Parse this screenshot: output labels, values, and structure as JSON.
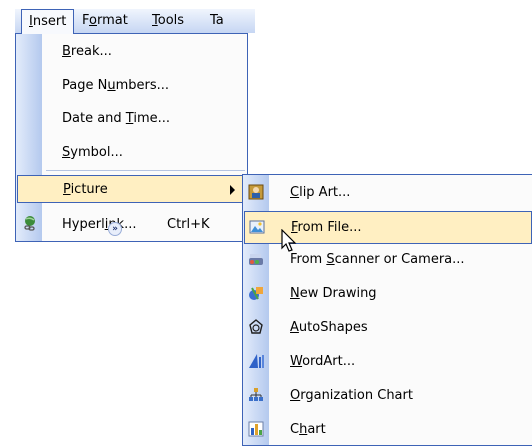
{
  "menubar": [
    {
      "label": "Insert",
      "u": "I",
      "rest": "nsert"
    },
    {
      "label": "Format",
      "pre": "F",
      "u": "o",
      "rest": "rmat"
    },
    {
      "label": "Tools",
      "u": "T",
      "rest": "ools"
    },
    {
      "label": "Ta"
    }
  ],
  "insert_menu": {
    "break": {
      "u": "B",
      "rest": "reak..."
    },
    "page_numbers": {
      "pre": "Page N",
      "u": "u",
      "rest": "mbers..."
    },
    "date_time": {
      "pre": "Date and ",
      "u": "T",
      "rest": "ime..."
    },
    "symbol": {
      "u": "S",
      "rest": "ymbol..."
    },
    "picture": {
      "u": "P",
      "rest": "icture"
    },
    "hyperlink": {
      "pre": "Hyperl",
      "u": "i",
      "rest": "nk...",
      "shortcut": "Ctrl+K"
    },
    "expand": "»"
  },
  "picture_submenu": [
    {
      "id": "clip-art",
      "u": "C",
      "rest": "lip Art...",
      "icon": "clip-art-icon"
    },
    {
      "id": "from-file",
      "u": "F",
      "rest": "rom File...",
      "icon": "from-file-icon"
    },
    {
      "id": "scanner",
      "pre": "From ",
      "u": "S",
      "rest": "canner or Camera...",
      "icon": "scanner-icon"
    },
    {
      "id": "new-drawing",
      "u": "N",
      "rest": "ew Drawing",
      "icon": "new-drawing-icon"
    },
    {
      "id": "autoshapes",
      "u": "A",
      "rest": "utoShapes",
      "icon": "autoshapes-icon"
    },
    {
      "id": "wordart",
      "u": "W",
      "rest": "ordArt...",
      "icon": "wordart-icon"
    },
    {
      "id": "org-chart",
      "u": "O",
      "rest": "rganization Chart",
      "icon": "org-chart-icon"
    },
    {
      "id": "chart",
      "pre": "C",
      "u": "h",
      "rest": "art",
      "icon": "chart-icon"
    }
  ]
}
